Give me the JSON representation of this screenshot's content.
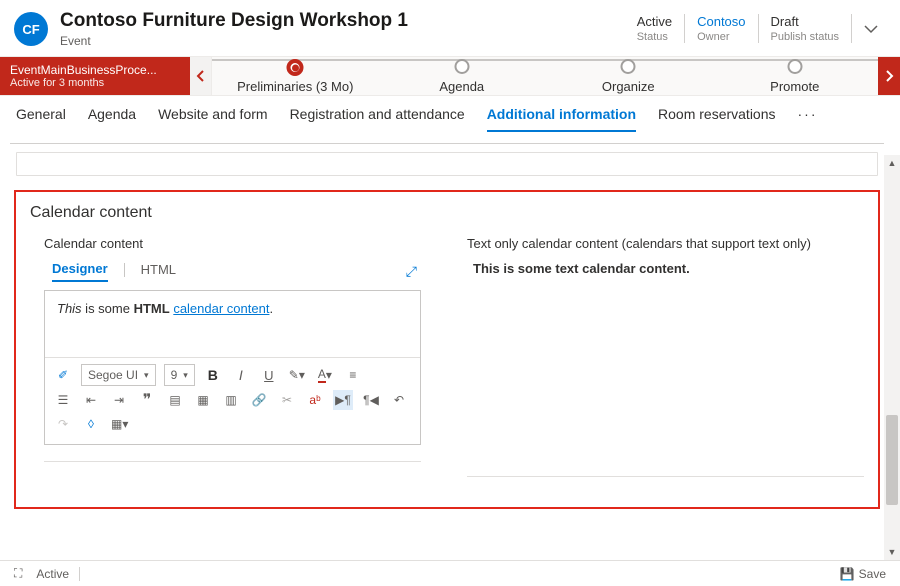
{
  "header": {
    "avatar_initials": "CF",
    "title": "Contoso Furniture Design Workshop 1",
    "subtitle": "Event",
    "status": [
      {
        "value": "Active",
        "label": "Status",
        "link": false
      },
      {
        "value": "Contoso",
        "label": "Owner",
        "link": true
      },
      {
        "value": "Draft",
        "label": "Publish status",
        "link": false
      }
    ]
  },
  "bpf": {
    "name": "EventMainBusinessProce...",
    "duration": "Active for 3 months",
    "stages": [
      {
        "label": "Preliminaries  (3 Mo)",
        "active": true
      },
      {
        "label": "Agenda",
        "active": false
      },
      {
        "label": "Organize",
        "active": false
      },
      {
        "label": "Promote",
        "active": false
      }
    ]
  },
  "tabs": [
    {
      "label": "General",
      "active": false
    },
    {
      "label": "Agenda",
      "active": false
    },
    {
      "label": "Website and form",
      "active": false
    },
    {
      "label": "Registration and attendance",
      "active": false
    },
    {
      "label": "Additional information",
      "active": true
    },
    {
      "label": "Room reservations",
      "active": false
    }
  ],
  "tabs_more": "···",
  "section": {
    "title": "Calendar content",
    "left": {
      "label": "Calendar content",
      "editor_tabs": [
        {
          "label": "Designer",
          "active": true
        },
        {
          "label": "HTML",
          "active": false
        }
      ],
      "html_content": {
        "prefix": "This",
        "mid": " is some ",
        "bold": "HTML",
        "link": "calendar content",
        "suffix": "."
      },
      "toolbar": {
        "font": "Segoe UI",
        "size": "9"
      }
    },
    "right": {
      "label": "Text only calendar content (calendars that support text only)",
      "value": "This is some text calendar content."
    }
  },
  "footer": {
    "status": "Active",
    "save": "Save"
  }
}
